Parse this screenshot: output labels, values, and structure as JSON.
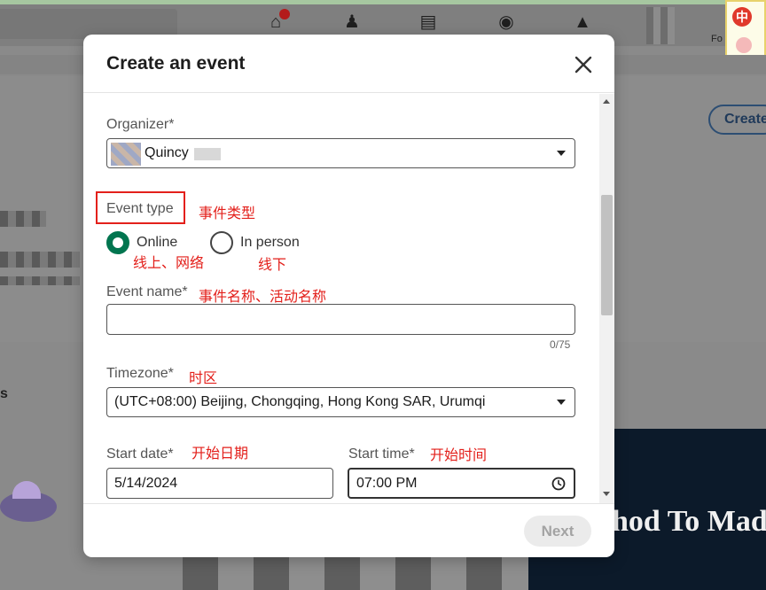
{
  "background": {
    "nav_label_for": "Fo",
    "create_button": "Create",
    "sticker_glyph": "中",
    "image_caption": "hod To Mad"
  },
  "modal": {
    "title": "Create an event",
    "close_icon": "close-icon",
    "organizer": {
      "label": "Organizer*",
      "value": "Quincy"
    },
    "event_type": {
      "label": "Event type",
      "annotation": "事件类型",
      "options": [
        {
          "label": "Online",
          "annotation": "线上、网络",
          "selected": true
        },
        {
          "label": "In person",
          "annotation": "线下",
          "selected": false
        }
      ]
    },
    "event_name": {
      "label": "Event name*",
      "annotation": "事件名称、活动名称",
      "value": "",
      "counter": "0/75"
    },
    "timezone": {
      "label": "Timezone*",
      "annotation": "时区",
      "value": "(UTC+08:00) Beijing, Chongqing, Hong Kong SAR, Urumqi"
    },
    "start_date": {
      "label": "Start date*",
      "annotation": "开始日期",
      "value": "5/14/2024"
    },
    "start_time": {
      "label": "Start time*",
      "annotation": "开始时间",
      "value": "07:00 PM"
    },
    "next_button": "Next"
  },
  "colors": {
    "accent_green": "#01754f",
    "annotation_red": "#e3201b",
    "disabled_button": "#ebebeb"
  }
}
